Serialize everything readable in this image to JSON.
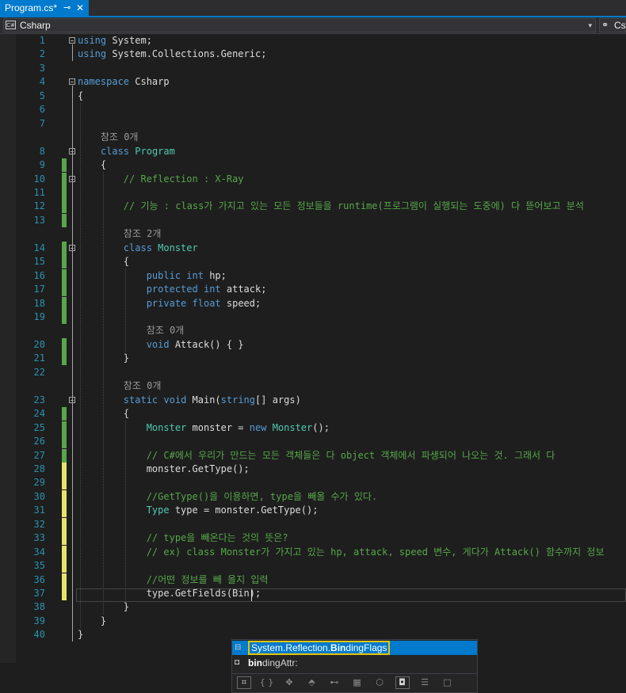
{
  "tab": {
    "title": "Program.cs*",
    "pin_glyph": "⊸",
    "close_glyph": "✕"
  },
  "nav": {
    "project": "Csharp",
    "project2": "Cs",
    "cs_icon": "C#"
  },
  "colors": {
    "keyword": "#569cd6",
    "type": "#4ec9b0",
    "comment": "#57a64a",
    "string": "#d69d85",
    "line_number": "#2b91af",
    "accent": "#007acc",
    "saved_change": "#57a64a",
    "unsaved_change": "#e5e46a"
  },
  "lines": [
    {
      "n": "1",
      "segs": [
        {
          "t": "using",
          "c": "kw"
        },
        {
          "t": " System;",
          "c": "pl"
        }
      ]
    },
    {
      "n": "2",
      "segs": [
        {
          "t": "using",
          "c": "kw"
        },
        {
          "t": " System.Collections.Generic;",
          "c": "pl"
        }
      ]
    },
    {
      "n": "3",
      "segs": []
    },
    {
      "n": "4",
      "segs": [
        {
          "t": "namespace",
          "c": "kw"
        },
        {
          "t": " Csharp",
          "c": "pl"
        }
      ]
    },
    {
      "n": "5",
      "segs": [
        {
          "t": "{",
          "c": "pl"
        }
      ]
    },
    {
      "n": "6",
      "segs": []
    },
    {
      "n": "7",
      "segs": []
    },
    {
      "lens": "참조 0개"
    },
    {
      "n": "8",
      "segs": [
        {
          "t": "    ",
          "c": "pl"
        },
        {
          "t": "class",
          "c": "kw"
        },
        {
          "t": " ",
          "c": "pl"
        },
        {
          "t": "Program",
          "c": "ty"
        }
      ]
    },
    {
      "n": "9",
      "segs": [
        {
          "t": "    {",
          "c": "pl"
        }
      ]
    },
    {
      "n": "10",
      "segs": [
        {
          "t": "        // Reflection : X-Ray",
          "c": "cm"
        }
      ]
    },
    {
      "n": "11",
      "segs": []
    },
    {
      "n": "12",
      "segs": [
        {
          "t": "        // 기능 : class가 가지고 있는 모든 정보들을 runtime(프로그램이 실행되는 도중에) 다 뜯어보고 분석",
          "c": "cm"
        }
      ]
    },
    {
      "n": "13",
      "segs": []
    },
    {
      "lens": "참조 2개"
    },
    {
      "n": "14",
      "segs": [
        {
          "t": "        ",
          "c": "pl"
        },
        {
          "t": "class",
          "c": "kw"
        },
        {
          "t": " ",
          "c": "pl"
        },
        {
          "t": "Monster",
          "c": "ty"
        }
      ]
    },
    {
      "n": "15",
      "segs": [
        {
          "t": "        {",
          "c": "pl"
        }
      ]
    },
    {
      "n": "16",
      "segs": [
        {
          "t": "            ",
          "c": "pl"
        },
        {
          "t": "public",
          "c": "kw"
        },
        {
          "t": " ",
          "c": "pl"
        },
        {
          "t": "int",
          "c": "kw"
        },
        {
          "t": " hp;",
          "c": "pl"
        }
      ]
    },
    {
      "n": "17",
      "segs": [
        {
          "t": "            ",
          "c": "pl"
        },
        {
          "t": "protected",
          "c": "kw"
        },
        {
          "t": " ",
          "c": "pl"
        },
        {
          "t": "int",
          "c": "kw"
        },
        {
          "t": " attack;",
          "c": "pl"
        }
      ]
    },
    {
      "n": "18",
      "segs": [
        {
          "t": "            ",
          "c": "pl"
        },
        {
          "t": "private",
          "c": "kw"
        },
        {
          "t": " ",
          "c": "pl"
        },
        {
          "t": "float",
          "c": "kw"
        },
        {
          "t": " speed;",
          "c": "pl"
        }
      ]
    },
    {
      "n": "19",
      "segs": []
    },
    {
      "lens": "참조 0개"
    },
    {
      "n": "20",
      "segs": [
        {
          "t": "            ",
          "c": "pl"
        },
        {
          "t": "void",
          "c": "kw"
        },
        {
          "t": " Attack() { }",
          "c": "pl"
        }
      ]
    },
    {
      "n": "21",
      "segs": [
        {
          "t": "        }",
          "c": "pl"
        }
      ]
    },
    {
      "n": "22",
      "segs": []
    },
    {
      "lens": "참조 0개"
    },
    {
      "n": "23",
      "segs": [
        {
          "t": "        ",
          "c": "pl"
        },
        {
          "t": "static",
          "c": "kw"
        },
        {
          "t": " ",
          "c": "pl"
        },
        {
          "t": "void",
          "c": "kw"
        },
        {
          "t": " Main(",
          "c": "pl"
        },
        {
          "t": "string",
          "c": "kw"
        },
        {
          "t": "[] args)",
          "c": "pl"
        }
      ]
    },
    {
      "n": "24",
      "segs": [
        {
          "t": "        {",
          "c": "pl"
        }
      ]
    },
    {
      "n": "25",
      "segs": [
        {
          "t": "            ",
          "c": "pl"
        },
        {
          "t": "Monster",
          "c": "ty"
        },
        {
          "t": " monster = ",
          "c": "pl"
        },
        {
          "t": "new",
          "c": "kw"
        },
        {
          "t": " ",
          "c": "pl"
        },
        {
          "t": "Monster",
          "c": "ty"
        },
        {
          "t": "();",
          "c": "pl"
        }
      ]
    },
    {
      "n": "26",
      "segs": []
    },
    {
      "n": "27",
      "segs": [
        {
          "t": "            // C#에서 우리가 만드는 모든 객체들은 다 object 객체에서 파생되어 나오는 것. 그래서 다",
          "c": "cm"
        }
      ]
    },
    {
      "n": "28",
      "segs": [
        {
          "t": "            monster.GetType();",
          "c": "pl"
        }
      ]
    },
    {
      "n": "29",
      "segs": []
    },
    {
      "n": "30",
      "segs": [
        {
          "t": "            //GetType()을 이용하면, type을 빼올 수가 있다.",
          "c": "cm"
        }
      ]
    },
    {
      "n": "31",
      "segs": [
        {
          "t": "            ",
          "c": "pl"
        },
        {
          "t": "Type",
          "c": "ty"
        },
        {
          "t": " type = monster.GetType();",
          "c": "pl"
        }
      ]
    },
    {
      "n": "32",
      "segs": []
    },
    {
      "n": "33",
      "segs": [
        {
          "t": "            // type을 빼온다는 것의 뜻은?",
          "c": "cm"
        }
      ]
    },
    {
      "n": "34",
      "segs": [
        {
          "t": "            // ex) class Monster가 가지고 있는 hp, attack, speed 변수, 게다가 Attack() 함수까지 정보",
          "c": "cm"
        }
      ]
    },
    {
      "n": "35",
      "segs": []
    },
    {
      "n": "36",
      "segs": [
        {
          "t": "            //어떤 정보를 빼 올지 입력",
          "c": "cm"
        }
      ]
    },
    {
      "n": "37",
      "segs": [
        {
          "t": "            type.GetFields(Bin);",
          "c": "pl"
        }
      ]
    },
    {
      "n": "38",
      "segs": [
        {
          "t": "        }",
          "c": "pl"
        }
      ]
    },
    {
      "n": "39",
      "segs": [
        {
          "t": "    }",
          "c": "pl"
        }
      ]
    },
    {
      "n": "40",
      "segs": [
        {
          "t": "}",
          "c": "pl"
        }
      ]
    }
  ],
  "completion": {
    "items": [
      {
        "icon": "⊟",
        "prefix": "System.Reflection.",
        "bold": "Bin",
        "suffix": "dingFlags",
        "selected": true
      },
      {
        "icon": "◘",
        "prefix": "",
        "bold": "bin",
        "suffix": "dingAttr:",
        "selected": false
      }
    ],
    "filters": [
      "⌗",
      "{ }",
      "✥",
      "⬘",
      "⊷",
      "▦",
      "⬡",
      "◘",
      "☰",
      "□"
    ]
  }
}
